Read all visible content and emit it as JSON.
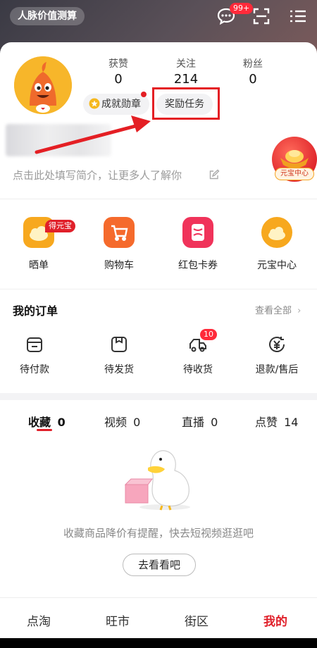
{
  "header": {
    "pill_label": "人脉价值测算",
    "message_badge": "99+"
  },
  "profile": {
    "stats": [
      {
        "label": "获赞",
        "value": "0"
      },
      {
        "label": "关注",
        "value": "214"
      },
      {
        "label": "粉丝",
        "value": "0"
      }
    ],
    "achievement_chip": "成就勋章",
    "reward_chip": "奖励任务",
    "bio_placeholder": "点击此处填写简介，让更多人了解你",
    "yuanbao_float_label": "元宝中心"
  },
  "quick_actions": [
    {
      "label": "晒单",
      "badge": "得元宝"
    },
    {
      "label": "购物车"
    },
    {
      "label": "红包卡券"
    },
    {
      "label": "元宝中心"
    }
  ],
  "orders": {
    "title": "我的订单",
    "view_all": "查看全部",
    "items": [
      {
        "label": "待付款"
      },
      {
        "label": "待发货"
      },
      {
        "label": "待收货",
        "badge": "10"
      },
      {
        "label": "退款/售后"
      }
    ]
  },
  "favorites": {
    "tabs": [
      {
        "label": "收藏",
        "count": "0"
      },
      {
        "label": "视频",
        "count": "0"
      },
      {
        "label": "直播",
        "count": "0"
      },
      {
        "label": "点赞",
        "count": "14"
      }
    ],
    "empty_text": "收藏商品降价有提醒，快去短视频逛逛吧",
    "go_button": "去看看吧"
  },
  "bottom_nav": [
    {
      "label": "点淘"
    },
    {
      "label": "旺市"
    },
    {
      "label": "街区"
    },
    {
      "label": "我的"
    }
  ],
  "colors": {
    "accent_red": "#e0202a",
    "annotation_red": "#e41f24"
  },
  "icons": {
    "header": [
      "message-icon",
      "scan-icon",
      "menu-icon"
    ],
    "orders": [
      "wallet-icon",
      "package-icon",
      "truck-icon",
      "refund-icon"
    ]
  }
}
